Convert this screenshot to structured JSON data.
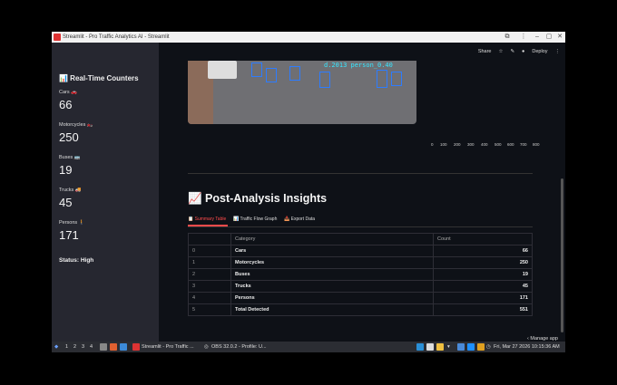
{
  "window": {
    "title": "Streamlit - Pro Traffic Analytics AI - Streamlit"
  },
  "toolbar": {
    "share": "Share",
    "deploy": "Deploy"
  },
  "sidebar": {
    "title": "📊 Real-Time Counters",
    "metrics": [
      {
        "label": "Cars 🚗",
        "value": "66"
      },
      {
        "label": "Motorcycles 🏍️",
        "value": "250"
      },
      {
        "label": "Buses 🚌",
        "value": "19"
      },
      {
        "label": "Trucks 🚚",
        "value": "45"
      },
      {
        "label": "Persons 🚶",
        "value": "171"
      }
    ],
    "status": "Status: High"
  },
  "video": {
    "overlay_text": "d.2013 person_0.40"
  },
  "axis_ticks": [
    "0",
    "100",
    "200",
    "300",
    "400",
    "500",
    "600",
    "700",
    "800"
  ],
  "section": {
    "heading": "📈 Post-Analysis Insights",
    "tabs": [
      "📋 Summary Table",
      "📊 Traffic Flow Graph",
      "📥 Export Data"
    ]
  },
  "table": {
    "headers": [
      "",
      "Category",
      "Count"
    ],
    "rows": [
      {
        "idx": "0",
        "category": "Cars",
        "count": "66"
      },
      {
        "idx": "1",
        "category": "Motorcycles",
        "count": "250"
      },
      {
        "idx": "2",
        "category": "Buses",
        "count": "19"
      },
      {
        "idx": "3",
        "category": "Trucks",
        "count": "45"
      },
      {
        "idx": "4",
        "category": "Persons",
        "count": "171"
      },
      {
        "idx": "5",
        "category": "Total Detected",
        "count": "551"
      }
    ]
  },
  "manage_app": "Manage app",
  "taskbar": {
    "workspaces": [
      "1",
      "2",
      "3",
      "4"
    ],
    "task1": "Streamlit - Pro Traffic ...",
    "task2": "OBS 32.0.2 - Profile: U...",
    "clock": "Fri, Mar 27 2026 10:15:36 AM"
  }
}
